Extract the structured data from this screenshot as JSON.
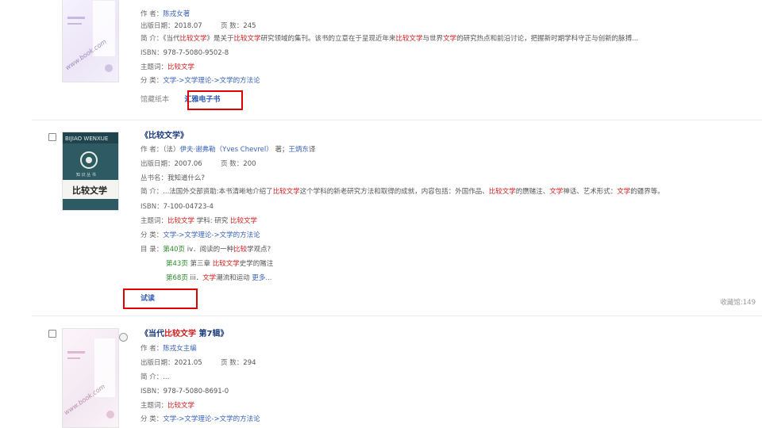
{
  "item1": {
    "author_label": "作 者：",
    "author": "陈戎女著",
    "date_label": "出版日期：",
    "date": "2018.07",
    "pages_label": "页 数：",
    "pages": "245",
    "summary_label": "简 介：",
    "summary_pre": "《当代",
    "summary_hl1": "比较文学",
    "summary_mid1": "》是关于",
    "summary_hl2": "比较文学",
    "summary_mid2": "研究领域的集刊。该书的立意在于呈现近年来",
    "summary_hl3": "比较文学",
    "summary_mid3": "与世界",
    "summary_hl4": "文学",
    "summary_post": "的研究热点和前沿讨论，把握新时期学科守正与创新的脉搏...",
    "isbn_label": "ISBN：",
    "isbn": "978-7-5080-9502-8",
    "subject_label": "主题词：",
    "subject": "比较文学",
    "class_label": "分 类：",
    "class_path": "文学->文学理论->文学的方法论",
    "holding": "馆藏纸本",
    "ebook_button": "汇雅电子书"
  },
  "item2": {
    "title": "《比较文学》",
    "author_label": "作 者：",
    "author_pre": "（法）",
    "author_name": "伊夫·谢弗勒（Yves Chevrel）",
    "author_mid": " 著；",
    "translator": "王炳东",
    "translator_suffix": "译",
    "date_label": "出版日期：",
    "date": "2007.06",
    "pages_label": "页 数：",
    "pages": "200",
    "series_label": "丛书名：",
    "series": "我知道什么?",
    "summary_label": "简 介：",
    "summary_pre": "...法国外交部资助:本书清晰地介绍了",
    "summary_hl1": "比较文学",
    "summary_mid1": "这个学科的新老研究方法和取得的成就，内容包括：外国作品、",
    "summary_hl2": "比较文学",
    "summary_mid2": "的赝赌注、",
    "summary_hl3": "文学",
    "summary_mid3": "神话、艺术形式：",
    "summary_hl4": "文学",
    "summary_post": "的疆界等。",
    "isbn_label": "ISBN：",
    "isbn": "7-100-04723-4",
    "subject_label": "主题词：",
    "subject1": "比较文学",
    "subject_mid": " 学科: 研究 ",
    "subject2": "比较文学",
    "class_label": "分 类：",
    "class_path": "文学->文学理论->文学的方法论",
    "toc_label": "目 录：",
    "toc1_page": "第40页",
    "toc1_pre": " iv．阅读的一种",
    "toc1_hl": "比较",
    "toc1_post": "学观点?",
    "toc2_page": "第43页",
    "toc2_pre": " 第三章  ",
    "toc2_hl": "比较文学",
    "toc2_post": "史学的赌注",
    "toc3_page": "第68页",
    "toc3_pre": " iii．",
    "toc3_hl": "文学",
    "toc3_post": "潮流和运动 ",
    "toc_more": "更多...",
    "trial_button": "试读",
    "favorites": "收藏馆:149",
    "cover_top": "BIJIAO WENXUE",
    "cover_title": "比较文学"
  },
  "item3": {
    "title_pre": "《当代",
    "title_hl": "比较文学",
    "title_post": " 第7辑》",
    "author_label": "作 者：",
    "author": "陈戎女主编",
    "date_label": "出版日期：",
    "date": "2021.05",
    "pages_label": "页 数：",
    "pages": "294",
    "summary_label": "简 介：",
    "summary": "...",
    "isbn_label": "ISBN：",
    "isbn": "978-7-5080-8691-0",
    "subject_label": "主题词：",
    "subject": "比较文学",
    "class_label": "分 类：",
    "class_path": "文学->文学理论->文学的方法论"
  },
  "icons": {
    "checkbox": "checkbox-icon",
    "cover": "book-cover-image"
  },
  "colors": {
    "highlight": "#d11c1c",
    "link": "#3a63b8",
    "title": "#1a3a7a",
    "annotation_box": "#e00000"
  }
}
